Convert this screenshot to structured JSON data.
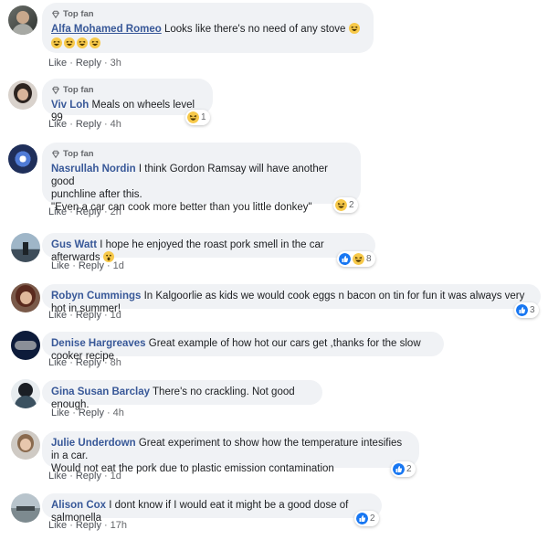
{
  "comments": [
    {
      "top_fan_label": "Top fan",
      "author": "Alfa Mohamed Romeo",
      "text": "Looks like there's no need of any stove",
      "emoji": "grinning-face-icon",
      "actions": {
        "like": "Like",
        "reply": "Reply",
        "time": "3h"
      }
    },
    {
      "top_fan_label": "Top fan",
      "author": "Viv Loh",
      "text": "Meals on wheels level 99",
      "reaction_count": "1",
      "actions": {
        "like": "Like",
        "reply": "Reply",
        "time": "4h"
      }
    },
    {
      "top_fan_label": "Top fan",
      "author": "Nasrullah Nordin",
      "text_line1": "I think Gordon Ramsay will have another good",
      "text_line2": "punchline after this.",
      "text_line3": "\"Even a car can cook more better than you little donkey\"",
      "reaction_count": "2",
      "actions": {
        "like": "Like",
        "reply": "Reply",
        "time": "2h"
      }
    },
    {
      "author": "Gus Watt",
      "text": "I hope he enjoyed the roast pork smell in the car afterwards",
      "reaction_count": "8",
      "actions": {
        "like": "Like",
        "reply": "Reply",
        "time": "1d"
      }
    },
    {
      "author": "Robyn Cummings",
      "text": "In Kalgoorlie as kids we would cook eggs n bacon on tin for fun it was always very hot in summer!",
      "reaction_count": "3",
      "actions": {
        "like": "Like",
        "reply": "Reply",
        "time": "1d"
      }
    },
    {
      "author": "Denise Hargreaves",
      "text": "Great example of how hot our cars get ,thanks for the slow cooker recipe",
      "actions": {
        "like": "Like",
        "reply": "Reply",
        "time": "8h"
      }
    },
    {
      "author": "Gina Susan Barclay",
      "text": "There's no crackling. Not good enough.",
      "actions": {
        "like": "Like",
        "reply": "Reply",
        "time": "4h"
      }
    },
    {
      "author": "Julie Underdown",
      "text_line1": "Great experiment to show how the temperature intesifies in a car.",
      "text_line2": "Would not eat the pork due to plastic emission contamination",
      "reaction_count": "2",
      "actions": {
        "like": "Like",
        "reply": "Reply",
        "time": "1d"
      }
    },
    {
      "author": "Alison Cox",
      "text": "I dont know if I would eat it might be a good dose of salmonella",
      "reaction_count": "2",
      "actions": {
        "like": "Like",
        "reply": "Reply",
        "time": "17h"
      }
    }
  ],
  "colors": {
    "author": "#385898",
    "bubble": "#f0f2f5",
    "like_blue": "#1877f2",
    "haha_yellow": "#f7c94a"
  }
}
